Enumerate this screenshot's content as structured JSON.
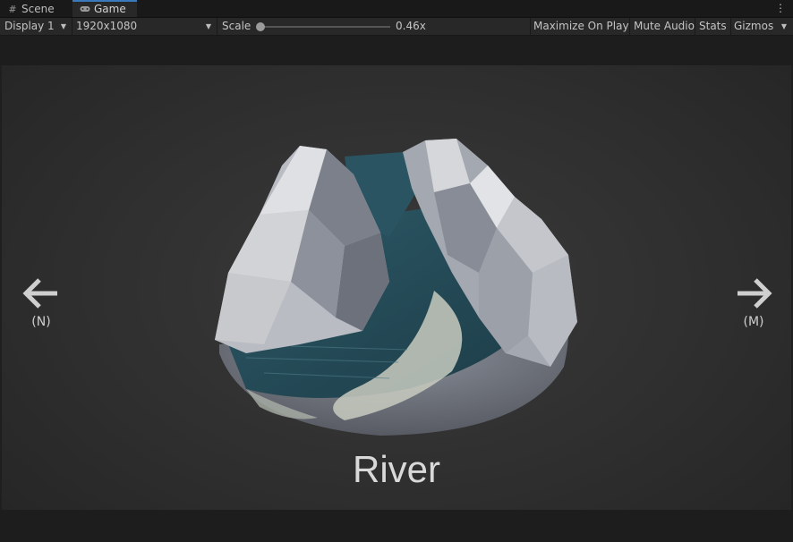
{
  "tabs": [
    {
      "label": "Scene",
      "icon": "grid-icon"
    },
    {
      "label": "Game",
      "icon": "gamepad-icon"
    }
  ],
  "toolbar": {
    "display": "Display 1",
    "resolution": "1920x1080",
    "scale_label": "Scale",
    "scale_value": "0.46x",
    "scale_fraction": 0.0,
    "maximize": "Maximize On Play",
    "mute": "Mute Audio",
    "stats": "Stats",
    "gizmos": "Gizmos"
  },
  "game": {
    "title": "River",
    "prev_key": "(N)",
    "next_key": "(M)"
  },
  "colors": {
    "tab_accent": "#3a79bb",
    "water": "#2f5a66",
    "rock": "#9ca3ad"
  }
}
